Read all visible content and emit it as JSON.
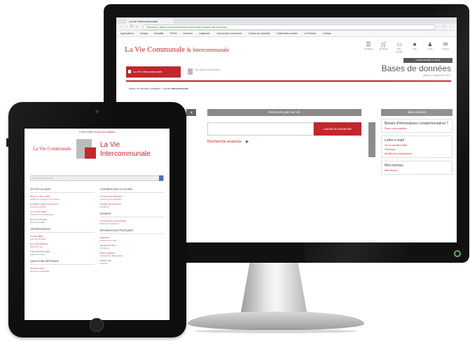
{
  "desktop": {
    "browser_tab": "La Vie Intercommunale",
    "url": "Sécurisé | https://www.lavieintercommunale.fr/bases-de-donnees",
    "bookmarks": [
      "Applications",
      "Google",
      "Actualité",
      "TIPAO",
      "LinkedIn",
      "Legifrance",
      "Journal des communes",
      "Chaîne de solidarité",
      "Collectivités locales",
      "Le Parisien",
      "Contact"
    ],
    "logo_main": "La Vie Communale",
    "logo_sup": "& Intercommunale",
    "header_icons": [
      "Actualités",
      "Boutique",
      "Mon compte",
      "Aide",
      "Profil",
      "Contact"
    ],
    "badge": "CODE ABONNÉ N° 00213",
    "tab_active": "La Vie Intercommunale",
    "tab_inactive": "Nos autres publications",
    "page_title": "Bases de données",
    "page_date": "Mardi 12 septembre 2017",
    "breadcrumb_root": "Bases de données juridiques",
    "breadcrumb_current": "La Vie Intercommunale",
    "center_header": "Recherche par mot clé",
    "search_placeholder": "",
    "search_button": "Lancer la recherche",
    "advanced_search": "Recherche avancée",
    "advanced_arrow": "▶",
    "services_header": "Mes services",
    "service_boxes": [
      {
        "title": "Besoin d'informations complémentaires ?",
        "links": [
          "Poser votre question"
        ]
      },
      {
        "title": "Lettre e-mail",
        "links": [
          "Voir la dernière lettre",
          "Historique",
          "Modifier les destinataires"
        ]
      },
      {
        "title": "Mon bureau",
        "links": [
          "Mes favoris"
        ]
      }
    ]
  },
  "tablet": {
    "top_text": "Portail réflexe",
    "top_link": "Accès aux éditions",
    "logo_small": "La Vie Communale",
    "logo_big_line1": "La Vie",
    "logo_big_line2": "Intercommunale",
    "search_placeholder": "Recherche sur le site",
    "columns": [
      {
        "sections": [
          {
            "heading": "Textes du mois",
            "items": [
              {
                "title": "Décret n° 2017-1299",
                "desc": "relatif aux conditions de gestion"
              },
              {
                "title": "Circulaire relative à la réforme",
                "desc": "intercommunalité"
              },
              {
                "title": "Loi n° 2017-1339",
                "desc": "mesures de simplification"
              },
              {
                "title": "Décret du 27 août",
                "desc": "finances locales"
              }
            ]
          },
          {
            "heading": "Jurisprudence",
            "items": [
              {
                "title": "Conseil d'État",
                "desc": "arrêt du 28 juillet"
              },
              {
                "title": "Cour administrative",
                "desc": "appel de Lyon"
              },
              {
                "title": "Tribunal administratif",
                "desc": "jugement rendu"
              }
            ]
          },
          {
            "heading": "Questions-réponses",
            "items": [
              {
                "title": "Question écrite",
                "desc": "réponse ministérielle"
              }
            ]
          }
        ]
      },
      {
        "sections": [
          {
            "heading": "Courrier des lecteurs",
            "items": [
              {
                "title": "Compétences des EPCI",
                "desc": "réponse de la rédaction"
              },
              {
                "title": "Transfert de personnel",
                "desc": "précisions"
              }
            ]
          },
          {
            "heading": "Dossier",
            "items": [
              {
                "title": "La fusion des communautés",
                "desc": "bilan et perspectives"
              }
            ]
          },
          {
            "heading": "Informations pratiques",
            "items": [
              {
                "title": "Calendrier",
                "desc": "échéances à venir"
              },
              {
                "title": "Agenda des élus",
                "desc": "formations"
              },
              {
                "title": "Fiches pratiques",
                "desc": "modèles de délibérations"
              },
              {
                "title": "Chiffres clés",
                "desc": "finances"
              }
            ]
          }
        ]
      }
    ]
  },
  "colors": {
    "brand_red": "#c1272d",
    "panel_gray": "#8a8a8a"
  }
}
